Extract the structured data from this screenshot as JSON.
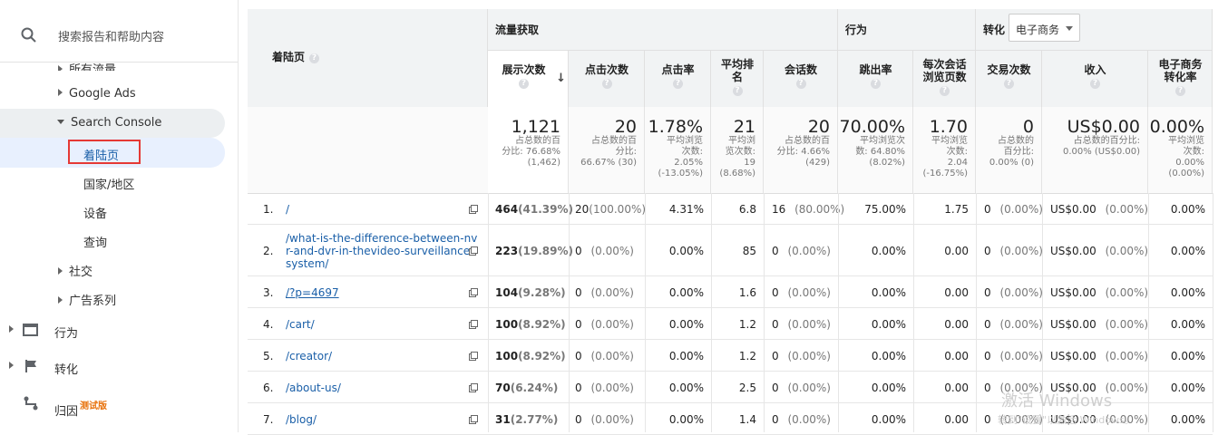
{
  "sidebar": {
    "search_placeholder": "搜索报告和帮助内容",
    "items": [
      {
        "label": "所有流量"
      },
      {
        "label": "Google Ads"
      },
      {
        "label": "Search Console"
      },
      {
        "label": "着陆页"
      },
      {
        "label": "国家/地区"
      },
      {
        "label": "设备"
      },
      {
        "label": "查询"
      },
      {
        "label": "社交"
      },
      {
        "label": "广告系列"
      },
      {
        "label": "行为"
      },
      {
        "label": "转化"
      },
      {
        "label": "归因",
        "badge": "测试版"
      }
    ]
  },
  "table": {
    "first_header": "着陆页",
    "groups": {
      "acquisition": "流量获取",
      "behavior": "行为",
      "conversion": "转化"
    },
    "conversion_select": "电子商务",
    "columns": [
      "展示次数",
      "点击次数",
      "点击率",
      "平均排名",
      "会话数",
      "跳出率",
      "每次会话浏览页数",
      "交易次数",
      "收入",
      "电子商务转化率"
    ],
    "columns_display": [
      "展示次数",
      "点击次数",
      "点击率",
      "平均排\n名",
      "会话数",
      "跳出率",
      "每次会话\n浏览页数",
      "交易次数",
      "收入",
      "电子商务\n转化率"
    ],
    "totals": [
      {
        "big": "1,121",
        "sub": "占总数的百\n分比: 76.68%\n(1,462)"
      },
      {
        "big": "20",
        "sub": "占总数的百\n分比:\n66.67% (30)"
      },
      {
        "big": "1.78%",
        "sub": "平均浏览\n次数:\n2.05%\n(-13.05%)"
      },
      {
        "big": "21",
        "sub": "平均浏\n览次数:\n19\n(8.68%)"
      },
      {
        "big": "20",
        "sub": "占总数的百\n分比: 4.66%\n(429)"
      },
      {
        "big": "70.00%",
        "sub": "平均浏览次\n数: 64.80%\n(8.02%)"
      },
      {
        "big": "1.70",
        "sub": "平均浏览\n次数:\n2.04\n(-16.75%)"
      },
      {
        "big": "0",
        "sub": "占总数的\n百分比:\n0.00% (0)"
      },
      {
        "big": "US$0.00",
        "sub": "占总数的百分比:\n0.00% (US$0.00)"
      },
      {
        "big": "0.00%",
        "sub": "平均浏览\n次数:\n0.00%\n(0.00%)"
      }
    ],
    "rows": [
      {
        "n": "1.",
        "page": "/",
        "impr": "464",
        "impr_pct": "(41.39%)",
        "clicks": "20",
        "clicks_pct": "(100.00%)",
        "ctr": "4.31%",
        "pos": "6.8",
        "sess": "16",
        "sess_pct": "(80.00%)",
        "bounce": "75.00%",
        "ppv": "1.75",
        "tx": "0",
        "tx_pct": "(0.00%)",
        "rev": "US$0.00",
        "rev_pct": "(0.00%)",
        "cr": "0.00%"
      },
      {
        "n": "2.",
        "page": "/what-is-the-difference-between-nv\nr-and-dvr-in-thevideo-surveillance-\nsystem/",
        "impr": "223",
        "impr_pct": "(19.89%)",
        "clicks": "0",
        "clicks_pct": "(0.00%)",
        "ctr": "0.00%",
        "pos": "85",
        "sess": "0",
        "sess_pct": "(0.00%)",
        "bounce": "0.00%",
        "ppv": "0.00",
        "tx": "0",
        "tx_pct": "(0.00%)",
        "rev": "US$0.00",
        "rev_pct": "(0.00%)",
        "cr": "0.00%"
      },
      {
        "n": "3.",
        "page": "/?p=4697",
        "impr": "104",
        "impr_pct": "(9.28%)",
        "clicks": "0",
        "clicks_pct": "(0.00%)",
        "ctr": "0.00%",
        "pos": "1.6",
        "sess": "0",
        "sess_pct": "(0.00%)",
        "bounce": "0.00%",
        "ppv": "0.00",
        "tx": "0",
        "tx_pct": "(0.00%)",
        "rev": "US$0.00",
        "rev_pct": "(0.00%)",
        "cr": "0.00%"
      },
      {
        "n": "4.",
        "page": "/cart/",
        "impr": "100",
        "impr_pct": "(8.92%)",
        "clicks": "0",
        "clicks_pct": "(0.00%)",
        "ctr": "0.00%",
        "pos": "1.2",
        "sess": "0",
        "sess_pct": "(0.00%)",
        "bounce": "0.00%",
        "ppv": "0.00",
        "tx": "0",
        "tx_pct": "(0.00%)",
        "rev": "US$0.00",
        "rev_pct": "(0.00%)",
        "cr": "0.00%"
      },
      {
        "n": "5.",
        "page": "/creator/",
        "impr": "100",
        "impr_pct": "(8.92%)",
        "clicks": "0",
        "clicks_pct": "(0.00%)",
        "ctr": "0.00%",
        "pos": "1.2",
        "sess": "0",
        "sess_pct": "(0.00%)",
        "bounce": "0.00%",
        "ppv": "0.00",
        "tx": "0",
        "tx_pct": "(0.00%)",
        "rev": "US$0.00",
        "rev_pct": "(0.00%)",
        "cr": "0.00%"
      },
      {
        "n": "6.",
        "page": "/about-us/",
        "impr": "70",
        "impr_pct": "(6.24%)",
        "clicks": "0",
        "clicks_pct": "(0.00%)",
        "ctr": "0.00%",
        "pos": "2.5",
        "sess": "0",
        "sess_pct": "(0.00%)",
        "bounce": "0.00%",
        "ppv": "0.00",
        "tx": "0",
        "tx_pct": "(0.00%)",
        "rev": "US$0.00",
        "rev_pct": "(0.00%)",
        "cr": "0.00%"
      },
      {
        "n": "7.",
        "page": "/blog/",
        "impr": "31",
        "impr_pct": "(2.77%)",
        "clicks": "0",
        "clicks_pct": "(0.00%)",
        "ctr": "0.00%",
        "pos": "1.4",
        "sess": "0",
        "sess_pct": "(0.00%)",
        "bounce": "0.00%",
        "ppv": "0.00",
        "tx": "0",
        "tx_pct": "(0.00%)",
        "rev": "US$0.00",
        "rev_pct": "(0.00%)",
        "cr": "0.00%"
      }
    ]
  },
  "watermark": {
    "line1": "激活 Windows",
    "line2": "转到\"设置\"以激活 Windows。"
  },
  "colors": {
    "link": "#1a5fa8",
    "highlight_border": "#e53935",
    "selected_bg": "#e8f0fe",
    "beta": "#e8710a"
  }
}
